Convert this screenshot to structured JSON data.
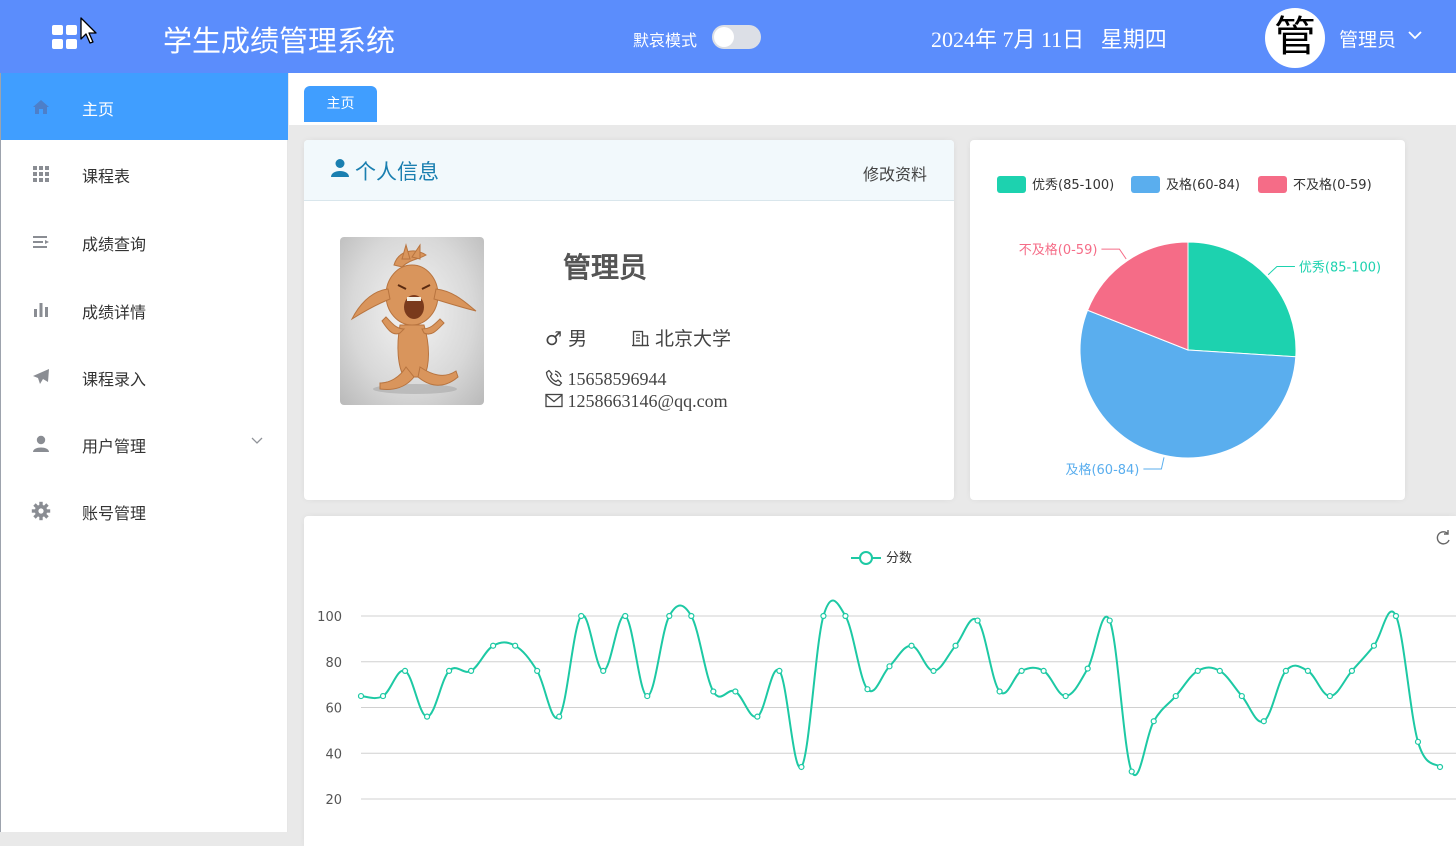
{
  "header": {
    "menu_icon": "grid-icon",
    "title": "学生成绩管理系统",
    "mode_label": "默哀模式",
    "mode_enabled": false,
    "date": "2024年 7月 11日",
    "weekday": "星期四",
    "avatar_text": "管",
    "user_name": "管理员",
    "bg_color": "#5b8dfc"
  },
  "sidebar": {
    "accent_color": "#409eff",
    "items": [
      {
        "label": "主页",
        "icon": "home-icon",
        "active": true
      },
      {
        "label": "课程表",
        "icon": "grid-icon"
      },
      {
        "label": "成绩查询",
        "icon": "list-icon"
      },
      {
        "label": "成绩详情",
        "icon": "bar-chart-icon"
      },
      {
        "label": "课程录入",
        "icon": "paper-plane-icon"
      },
      {
        "label": "用户管理",
        "icon": "user-icon",
        "has_submenu": true
      },
      {
        "label": "账号管理",
        "icon": "gear-icon"
      }
    ]
  },
  "tabs": [
    {
      "label": "主页",
      "active": true
    }
  ],
  "profile": {
    "card_title": "个人信息",
    "edit_label": "修改资料",
    "name": "管理员",
    "gender_symbol": "♂",
    "gender": "男",
    "school": "北京大学",
    "phone": "15658596944",
    "email": "1258663146@qq.com"
  },
  "chart_data": [
    {
      "type": "pie",
      "legend_position": "top",
      "slices": [
        {
          "name": "优秀(85-100)",
          "value": 26,
          "color": "#1dd2af"
        },
        {
          "name": "及格(60-84)",
          "value": 55,
          "color": "#5aaeee"
        },
        {
          "name": "不及格(0-59)",
          "value": 19,
          "color": "#f56c87"
        }
      ]
    },
    {
      "type": "line",
      "legend_position": "top",
      "grid": true,
      "ylim": [
        20,
        100
      ],
      "yticks": [
        20,
        40,
        60,
        80,
        100
      ],
      "series": [
        {
          "name": "分数",
          "color": "#1dc9a4",
          "smooth": true,
          "values": [
            65,
            65,
            76,
            56,
            76,
            76,
            87,
            87,
            76,
            56,
            100,
            76,
            100,
            65,
            100,
            100,
            67,
            67,
            56,
            76,
            34,
            100,
            100,
            68,
            78,
            87,
            76,
            87,
            98,
            67,
            76,
            76,
            65,
            77,
            98,
            32,
            54,
            65,
            76,
            76,
            65,
            54,
            76,
            76,
            65,
            76,
            87,
            100,
            45,
            34
          ]
        }
      ]
    }
  ]
}
